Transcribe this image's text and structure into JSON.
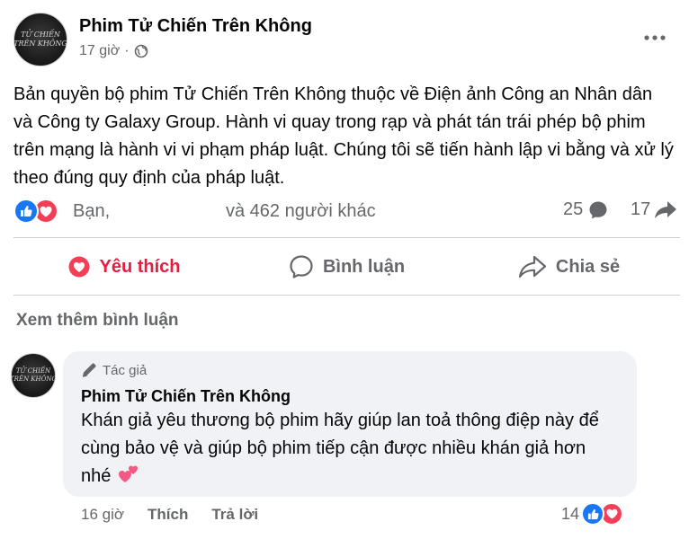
{
  "post": {
    "author": "Phim Tử Chiến Trên Không",
    "time": "17 giờ",
    "separator": "·",
    "privacy_icon": "globe-icon",
    "avatar_text": [
      "TỬ CHIẾN",
      "TRÊN KHÔNG"
    ],
    "body": "Bản quyền bộ phim Tử Chiến Trên Không thuộc về Điện ảnh Công an Nhân dân và Công ty Galaxy Group. Hành vi quay trong rạp và phát tán trái phép bộ phim trên mạng là hành vi vi phạm pháp luật. Chúng tôi sẽ tiến hành lập vi bằng và xử lý theo đúng quy định của pháp luật."
  },
  "reactions": {
    "you": "Bạn,",
    "others": "và 462 người khác",
    "comments": "25",
    "shares": "17",
    "icons": [
      "like-icon",
      "love-icon"
    ]
  },
  "actions": {
    "like": "Yêu thích",
    "comment": "Bình luận",
    "share": "Chia sẻ"
  },
  "see_more": "Xem thêm bình luận",
  "comment": {
    "badge": "Tác giả",
    "author": "Phim Tử Chiến Trên Không",
    "text": "Khán giả yêu thương bộ phim hãy giúp lan toả thông điệp này để cùng bảo vệ và giúp bộ phim tiếp cận được nhiều khán giả hơn nhé",
    "time": "16 giờ",
    "like": "Thích",
    "reply": "Trả lời",
    "reaction_count": "14"
  },
  "colors": {
    "like_blue": "#1877f2",
    "love_red": "#f33e58",
    "liked_text": "#e41e3f",
    "secondary_text": "#65676b",
    "bubble_bg": "#f0f2f5"
  }
}
